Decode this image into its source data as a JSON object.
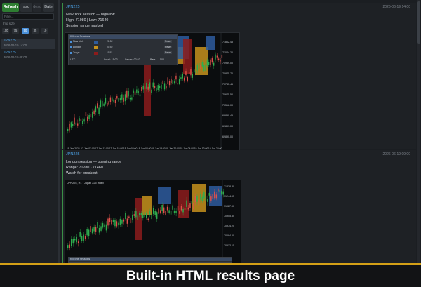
{
  "sidebar": {
    "refresh_label": "Refresh",
    "sort_asc_label": "asc",
    "sort_desc_label": "desc",
    "sort_date_label": "Date",
    "filter_placeholder": "Filter...",
    "size_label": "Img size:",
    "sizes": [
      "100",
      "75",
      "50",
      "35",
      "10"
    ],
    "active_size": "50",
    "items": [
      {
        "title": "JPN225",
        "date": "2026-06-19 14:00"
      },
      {
        "title": "JPN225",
        "date": "2026-06-19 09:00"
      }
    ]
  },
  "entries": [
    {
      "title": "JPN225",
      "timestamp": "2026-06-19 14:00",
      "lines": [
        "New York session — high/low",
        "High: 71980 | Low: 71640",
        "Session range marked"
      ]
    },
    {
      "title": "JPN225",
      "timestamp": "2026-06-19 09:00",
      "lines": [
        "London session — opening range",
        "Range: 71280 - 71460",
        "Watch for breakout"
      ]
    }
  ],
  "chart1": {
    "panel_title": "Killzone Sessions",
    "sessions": [
      {
        "name": "New York",
        "time": "21:52",
        "color": "#2e5c9e"
      },
      {
        "name": "London",
        "time": "00:52",
        "color": "#c7921c"
      },
      {
        "name": "Tokyo",
        "time": "11:52",
        "color": "#8c1c1c"
      }
    ],
    "reset_label": "Reset",
    "tz_label": "UTC",
    "local_label": "Local: 15:02",
    "server_label": "Server: 02:52",
    "bars_label": "Bars",
    "bars_value": "500",
    "y_ticks": [
      "71862.45",
      "71044.20",
      "70989.00",
      "70875.70",
      "70745.45",
      "70675.50",
      "70518.00",
      "69890.45",
      "69891.00",
      "69890.00"
    ],
    "x_ticks": [
      "18 Jun 2026",
      "17 Jun 03:00",
      "17 Jun 11:00",
      "17 Jun 18:00",
      "18 Jun 03:00",
      "18 Jun 08:00",
      "18 Jun 13:00",
      "18 Jun 20:00",
      "19 Jun 04:00",
      "19 Jun 12:00",
      "19 Jun 20:00"
    ]
  },
  "chart2": {
    "header_label": "JPN225, H1 · Japan 225 Index",
    "panel_title": "Killzone Sessions",
    "y_ticks": [
      "71328.80",
      "71244.95",
      "71027.90",
      "70905.30",
      "70974.25",
      "70694.60",
      "70512.15"
    ],
    "y_last": "71328.80"
  },
  "banner": {
    "text": "Built-in HTML results page"
  },
  "colors": {
    "up": "#2eae4e",
    "down": "#e0514a",
    "ny": "#2e5c9e",
    "london": "#c7921c",
    "tokyo": "#8c1c1c",
    "accent": "#4a9ee0"
  }
}
